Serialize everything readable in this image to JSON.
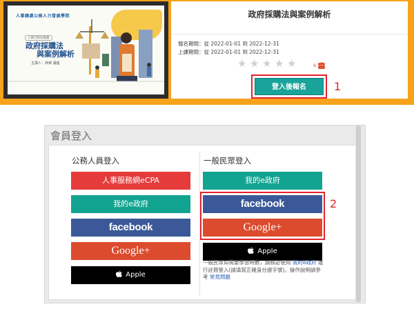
{
  "banner": {
    "brand": "人事總處公務人力發展學院",
    "thumb_badge": "人事行政局推薦",
    "thumb_title_line1": "政府採購法",
    "thumb_title_line2": "與案例解析",
    "thumb_speaker": "主講人：林榮 講座",
    "course_title": "政府採購法與案例解析",
    "signup_period": "報名期間：從 2022-01-01 到 2022-12-31",
    "online_period": "上課期間：從 2022-01-01 到 2022-12-31",
    "rating_stars": 0,
    "enroll_count": "6",
    "enroll_button": "登入後報名",
    "step_label": "1"
  },
  "login": {
    "title": "會員登入",
    "civil": {
      "heading": "公務人員登入",
      "buttons": [
        "人事服務網eCPA",
        "我的e政府",
        "facebook",
        "Google+",
        "Apple"
      ]
    },
    "public": {
      "heading": "一般民眾登入",
      "buttons": [
        "我的e政府",
        "facebook",
        "Google+",
        "Apple"
      ]
    },
    "note_text1": "一般民眾如需要學習時數，請務必使用",
    "note_link1": "我的e政府",
    "note_text2": "進行註冊登入(請填寫正確身分證字號)。操作說明請參考",
    "note_link2": "常見問題",
    "step_label": "2"
  },
  "colors": {
    "banner_bg": "#f7a21b",
    "enroll_btn": "#1aa39a",
    "highlight": "#e3232b",
    "ecpa": "#e63b3b",
    "egov": "#12a391",
    "facebook": "#3b5998",
    "google": "#dc4b2e",
    "apple": "#000000"
  }
}
